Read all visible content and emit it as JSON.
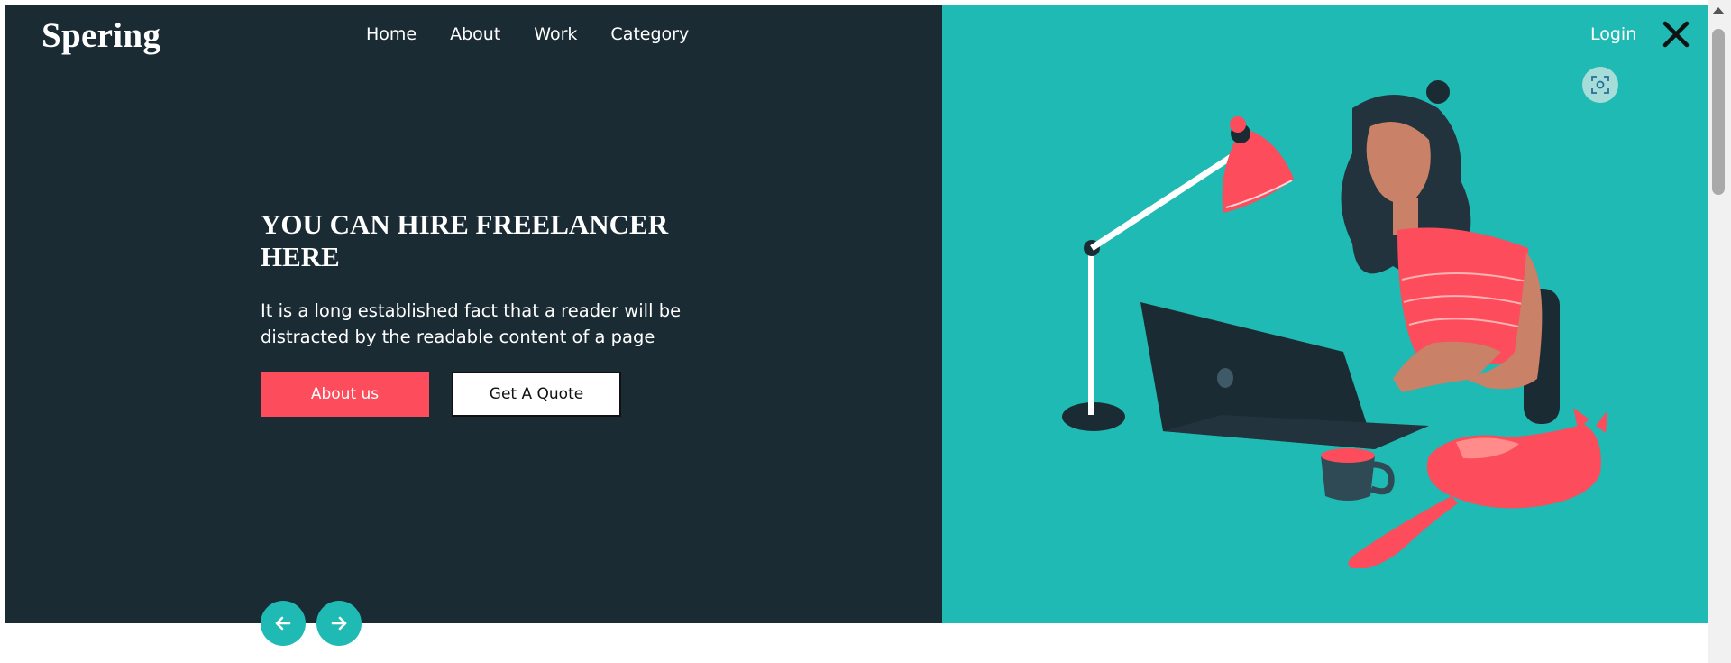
{
  "header": {
    "logo": "Spering",
    "nav": [
      "Home",
      "About",
      "Work",
      "Category"
    ],
    "login": "Login"
  },
  "hero": {
    "headline": "YOU CAN HIRE FREELANCER HERE",
    "description": "It is a long established fact that a reader will be distracted by the readable content of a page",
    "primary_button": "About us",
    "secondary_button": "Get A Quote"
  },
  "colors": {
    "dark_panel": "#1b2b34",
    "teal_panel": "#1ebab3",
    "accent_red": "#fd4c5c",
    "white": "#ffffff"
  },
  "icons": {
    "close": "close-icon",
    "lens": "screenshot-lens-icon",
    "prev": "arrow-left-icon",
    "next": "arrow-right-icon"
  }
}
